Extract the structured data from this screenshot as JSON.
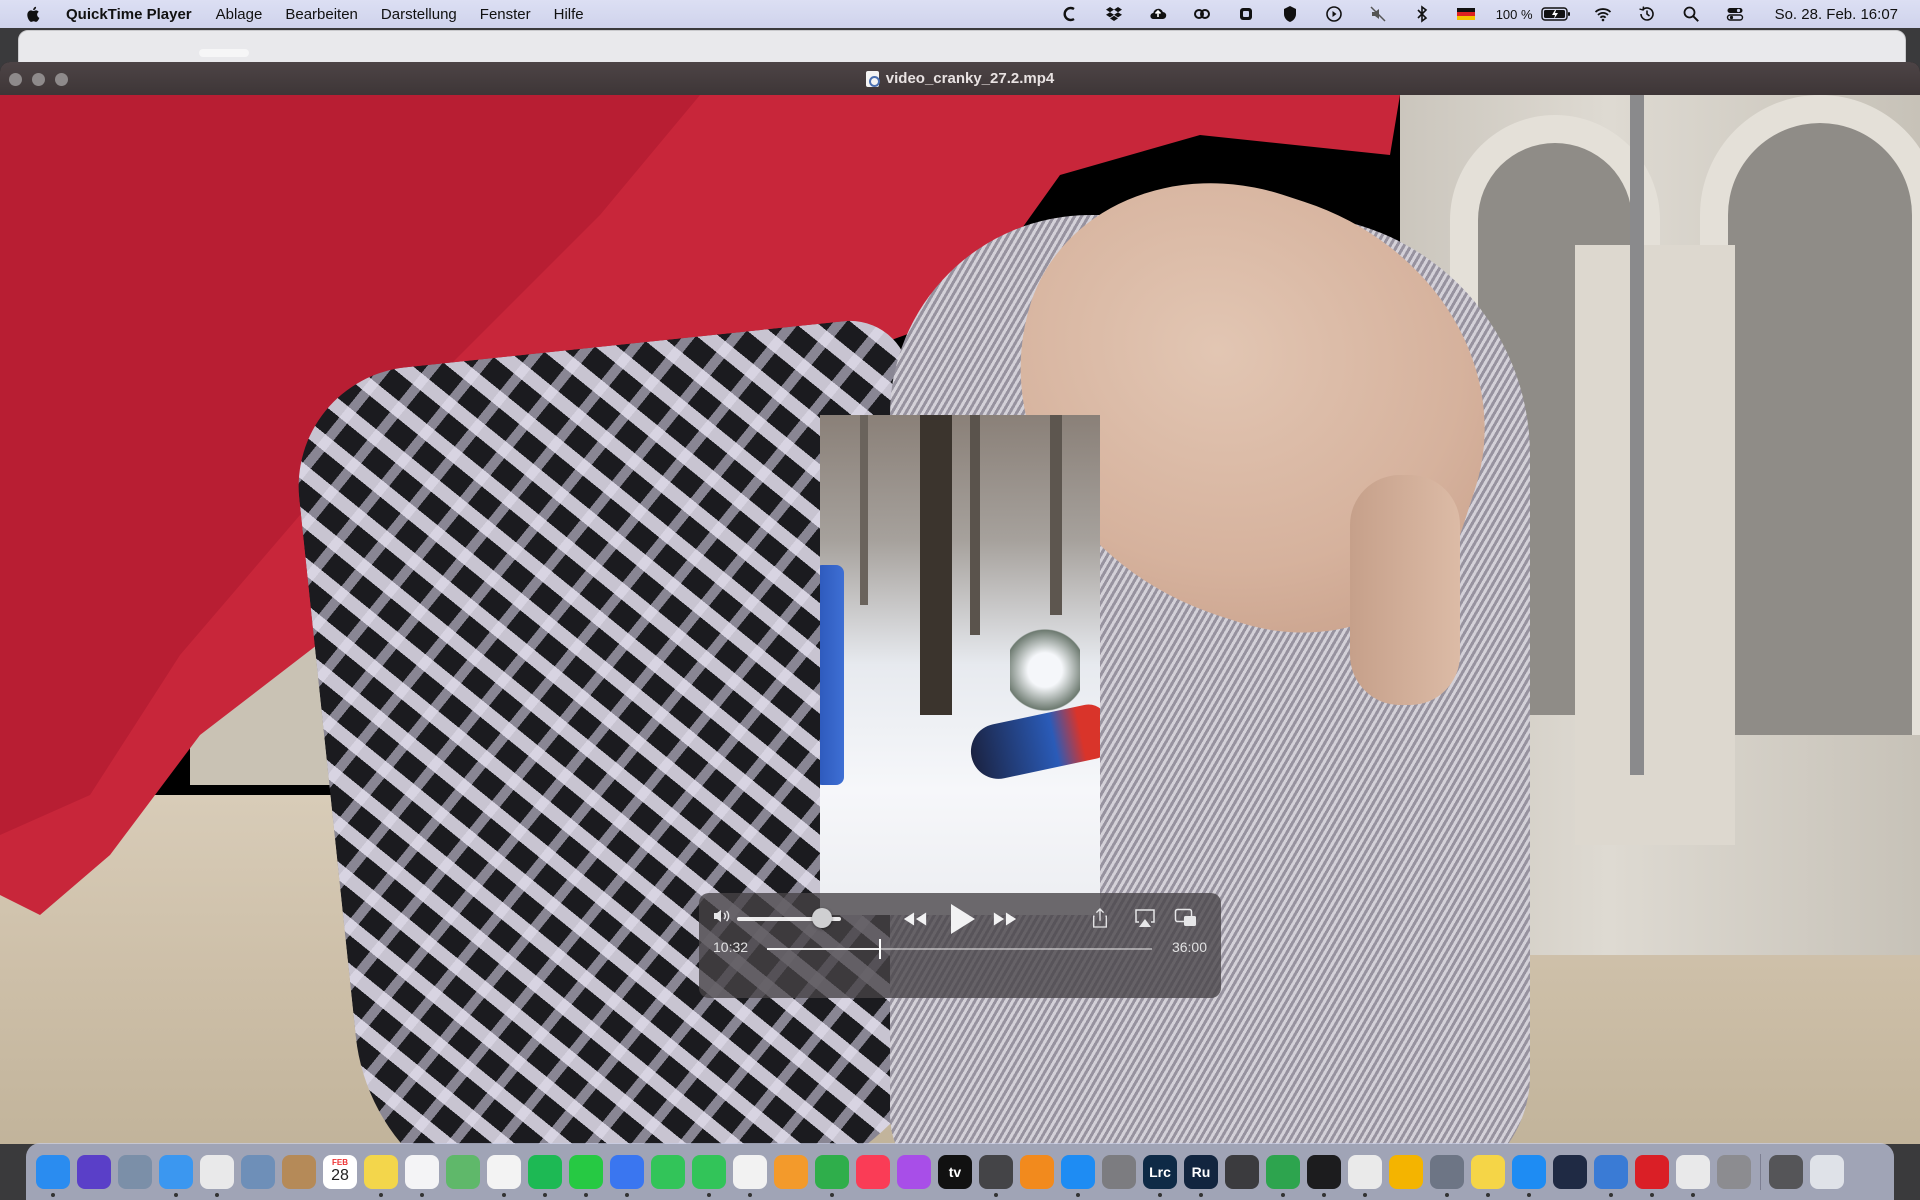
{
  "menubar": {
    "apple_icon": "apple-logo-icon",
    "app_name": "QuickTime Player",
    "menus": [
      "Ablage",
      "Bearbeiten",
      "Darstellung",
      "Fenster",
      "Hilfe"
    ],
    "status_icons": [
      "c-app-icon",
      "dropbox-icon",
      "cloud-upload-icon",
      "creative-cloud-icon",
      "vpn-icon",
      "shield-icon",
      "play-circle-icon",
      "mute-icon",
      "bluetooth-icon",
      "germany-flag-icon"
    ],
    "battery_text": "100 %",
    "clock": "So. 28. Feb.  16:07"
  },
  "window": {
    "title": "video_cranky_27.2.mp4"
  },
  "player": {
    "current_time": "10:32",
    "duration": "36:00",
    "volume_level": 0.82,
    "progress_fraction": 0.29
  },
  "dock": {
    "calendar_month": "FEB",
    "calendar_day": "28",
    "apps": [
      {
        "name": "finder-icon",
        "color": "#2a8cf0",
        "label": ""
      },
      {
        "name": "siri-icon",
        "color": "#5a3fc8",
        "label": ""
      },
      {
        "name": "launchpad-icon",
        "color": "#7b8fa8",
        "label": ""
      },
      {
        "name": "mail-icon",
        "color": "#3b97f0",
        "label": ""
      },
      {
        "name": "chrome-icon",
        "color": "#e9e9ea",
        "label": ""
      },
      {
        "name": "preview-icon",
        "color": "#6e8fb8",
        "label": ""
      },
      {
        "name": "contacts-icon",
        "color": "#b58a58",
        "label": ""
      },
      {
        "name": "calendar-icon",
        "color": "#ffffff",
        "label": ""
      },
      {
        "name": "notes-icon",
        "color": "#f3d64b",
        "label": ""
      },
      {
        "name": "reminders-icon",
        "color": "#f4f4f6",
        "label": ""
      },
      {
        "name": "maps-icon",
        "color": "#5fb86a",
        "label": ""
      },
      {
        "name": "photos-icon",
        "color": "#f3f3f3",
        "label": ""
      },
      {
        "name": "spotify-icon",
        "color": "#1db954",
        "label": ""
      },
      {
        "name": "whatsapp-icon",
        "color": "#26c943",
        "label": ""
      },
      {
        "name": "signal-icon",
        "color": "#3a76f0",
        "label": ""
      },
      {
        "name": "facetime-icon",
        "color": "#32c459",
        "label": ""
      },
      {
        "name": "messages-icon",
        "color": "#32c459",
        "label": ""
      },
      {
        "name": "textedit-icon",
        "color": "#f2f2f2",
        "label": ""
      },
      {
        "name": "pages-icon",
        "color": "#f39a2b",
        "label": ""
      },
      {
        "name": "numbers-icon",
        "color": "#2fae4b",
        "label": ""
      },
      {
        "name": "music-icon",
        "color": "#fa3c56",
        "label": ""
      },
      {
        "name": "podcasts-icon",
        "color": "#a84ee8",
        "label": ""
      },
      {
        "name": "appletv-icon",
        "color": "#111111",
        "label": "tv"
      },
      {
        "name": "screenshot-icon",
        "color": "#444447",
        "label": ""
      },
      {
        "name": "books-icon",
        "color": "#f28a1d",
        "label": ""
      },
      {
        "name": "appstore-icon",
        "color": "#1e8cf3",
        "label": ""
      },
      {
        "name": "system-preferences-icon",
        "color": "#7c7c80",
        "label": ""
      },
      {
        "name": "lightroom-icon",
        "color": "#0e2a46",
        "label": "Lrc"
      },
      {
        "name": "rush-icon",
        "color": "#12253f",
        "label": "Ru"
      },
      {
        "name": "calculator-icon",
        "color": "#3b3b3e",
        "label": ""
      },
      {
        "name": "istat-icon",
        "color": "#2da44e",
        "label": ""
      },
      {
        "name": "activity-icon",
        "color": "#1c1c1e",
        "label": ""
      },
      {
        "name": "solitaire-icon",
        "color": "#eaeaea",
        "label": ""
      },
      {
        "name": "keynote-icon",
        "color": "#f4b400",
        "label": ""
      },
      {
        "name": "archive-icon",
        "color": "#6d7585",
        "label": ""
      },
      {
        "name": "stickies-icon",
        "color": "#f5d547",
        "label": ""
      },
      {
        "name": "safari-icon",
        "color": "#1e8cf3",
        "label": ""
      },
      {
        "name": "prompt-icon",
        "color": "#1f2a44",
        "label": ""
      },
      {
        "name": "proxyman-icon",
        "color": "#3a7bd5",
        "label": ""
      },
      {
        "name": "creative-cloud-app-icon",
        "color": "#da1f26",
        "label": ""
      },
      {
        "name": "cleaner-icon",
        "color": "#e9e9ea",
        "label": ""
      },
      {
        "name": "camera-icon",
        "color": "#8c8c90",
        "label": ""
      },
      {
        "name": "film-icon",
        "color": "#555558",
        "label": ""
      },
      {
        "name": "trash-icon",
        "color": "#dfe2e8",
        "label": ""
      }
    ]
  }
}
